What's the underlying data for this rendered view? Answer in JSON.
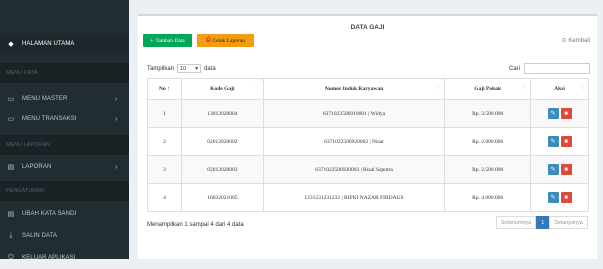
{
  "sidebar": {
    "items": [
      {
        "icon": "dashboard-icon",
        "glyph": "◆",
        "label": "HALAMAN UTAMA"
      },
      {
        "icon": "folder-icon",
        "glyph": "▭",
        "label": "MENU MASTER"
      },
      {
        "icon": "folder-icon",
        "glyph": "▭",
        "label": "MENU TRANSAKSI"
      },
      {
        "icon": "report-icon",
        "glyph": "▤",
        "label": "LAPORAN"
      },
      {
        "icon": "key-icon",
        "glyph": "▤",
        "label": "UBAH KATA SANDI"
      },
      {
        "icon": "download-icon",
        "glyph": "⤓",
        "label": "SALIN DATA"
      },
      {
        "icon": "logout-icon",
        "glyph": "⏻",
        "label": "KELUAR APLIKASI"
      }
    ],
    "headers": [
      "MENU DATA",
      "MENU LAPORAN",
      "PENGATURAN"
    ]
  },
  "box": {
    "title": "DATA GAJI",
    "add_label": "Tambah Data",
    "print_label": "Cetak Laporan",
    "back_label": "Kembali"
  },
  "table_controls": {
    "show_label": "Tampilkan",
    "show_value": "10",
    "entries_label": "data",
    "search_label": "Cari"
  },
  "table": {
    "headers": [
      "No",
      "Kode Gaji",
      "Nomor Induk Karyawan",
      "Gaji Pokok",
      "Aksi"
    ],
    "rows": [
      {
        "no": "1",
        "kode": "13012020004",
        "nik": "6371022506910001 | Widya",
        "gaji": "Rp. 3.500.000"
      },
      {
        "no": "2",
        "kode": "02012020002",
        "nik": "6371022506920002 | Nisar",
        "gaji": "Rp. 2.000.000"
      },
      {
        "no": "3",
        "kode": "02012020003",
        "nik": "6371022506930003 | Rizal Saputra",
        "gaji": "Rp. 2.500.000"
      },
      {
        "no": "4",
        "kode": "16032021005",
        "nik": "1231231231232 | RIFKI NAZAR FIRDAUS",
        "gaji": "Rp. 4.000.000"
      }
    ]
  },
  "footer": {
    "info": "Menampilkan 1 sampai 4 dari 4 data",
    "prev": "Sebelumnya",
    "current": "1",
    "next": "Selanjutnya"
  }
}
